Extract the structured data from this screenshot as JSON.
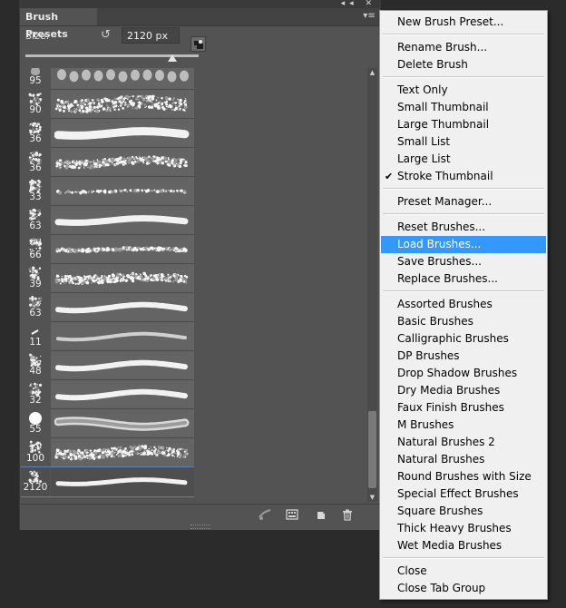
{
  "panel": {
    "tab_title": "Brush Presets",
    "size_label": "Size:",
    "size_value": "2120 px",
    "size_slider_level": 0.85,
    "panel_controls": "◂◂ ✕",
    "panel_menu_glyph": "▾≡"
  },
  "brushes": [
    {
      "size": "95"
    },
    {
      "size": "90"
    },
    {
      "size": "36"
    },
    {
      "size": "36"
    },
    {
      "size": "33"
    },
    {
      "size": "63"
    },
    {
      "size": "66"
    },
    {
      "size": "39"
    },
    {
      "size": "63"
    },
    {
      "size": "11"
    },
    {
      "size": "48"
    },
    {
      "size": "32"
    },
    {
      "size": "55"
    },
    {
      "size": "100"
    },
    {
      "size": "2120"
    }
  ],
  "bottom_icons": [
    "brush-toggle-icon",
    "brush-panel-icon",
    "new-brush-icon",
    "trash-icon"
  ],
  "menu": {
    "items": [
      {
        "label": "New Brush Preset..."
      },
      {
        "sep": true
      },
      {
        "label": "Rename Brush..."
      },
      {
        "label": "Delete Brush"
      },
      {
        "sep": true
      },
      {
        "label": "Text Only"
      },
      {
        "label": "Small Thumbnail"
      },
      {
        "label": "Large Thumbnail"
      },
      {
        "label": "Small List"
      },
      {
        "label": "Large List"
      },
      {
        "label": "Stroke Thumbnail",
        "checked": true
      },
      {
        "sep": true
      },
      {
        "label": "Preset Manager..."
      },
      {
        "sep": true
      },
      {
        "label": "Reset Brushes..."
      },
      {
        "label": "Load Brushes...",
        "highlighted": true
      },
      {
        "label": "Save Brushes..."
      },
      {
        "label": "Replace Brushes..."
      },
      {
        "sep": true
      },
      {
        "label": "Assorted Brushes"
      },
      {
        "label": "Basic Brushes"
      },
      {
        "label": "Calligraphic Brushes"
      },
      {
        "label": "DP Brushes"
      },
      {
        "label": "Drop Shadow Brushes"
      },
      {
        "label": "Dry Media Brushes"
      },
      {
        "label": "Faux Finish Brushes"
      },
      {
        "label": "M Brushes"
      },
      {
        "label": "Natural Brushes 2"
      },
      {
        "label": "Natural Brushes"
      },
      {
        "label": "Round Brushes with Size"
      },
      {
        "label": "Special Effect Brushes"
      },
      {
        "label": "Square Brushes"
      },
      {
        "label": "Thick Heavy Brushes"
      },
      {
        "label": "Wet Media Brushes"
      },
      {
        "sep": true
      },
      {
        "label": "Close"
      },
      {
        "label": "Close Tab Group"
      }
    ],
    "check_glyph": "✔"
  },
  "colors": {
    "panel_bg": "#535353",
    "menu_bg": "#f0f0f0",
    "highlight": "#3399ff"
  }
}
